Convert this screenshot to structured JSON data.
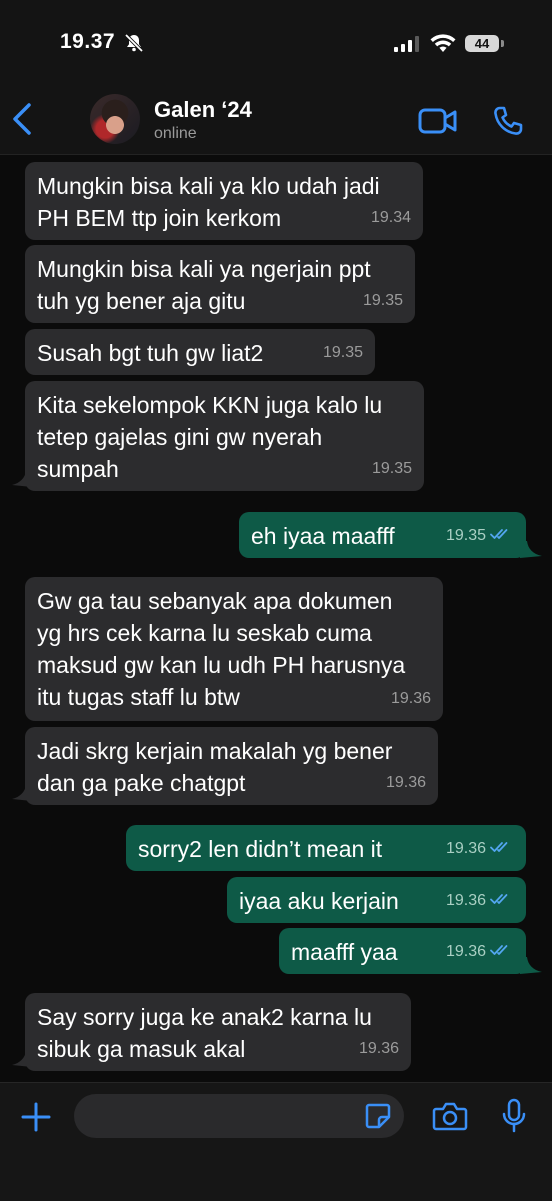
{
  "status_bar": {
    "time": "19.37",
    "battery": "44"
  },
  "header": {
    "contact_name": "Galen ‘24",
    "contact_status": "online"
  },
  "messages": [
    {
      "direction": "incoming",
      "text": "Mungkin bisa kali ya klo udah jadi\nPH BEM ttp join kerkom",
      "time": "19.34"
    },
    {
      "direction": "incoming",
      "text": "Mungkin bisa kali ya ngerjain ppt\ntuh yg bener aja gitu",
      "time": "19.35"
    },
    {
      "direction": "incoming",
      "text": "Susah bgt tuh gw liat2",
      "time": "19.35"
    },
    {
      "direction": "incoming",
      "text": "Kita sekelompok KKN juga kalo lu\ntetep gajelas gini gw nyerah\nsumpah",
      "time": "19.35"
    },
    {
      "direction": "outgoing",
      "text": "eh iyaa maafff",
      "time": "19.35",
      "status": "read"
    },
    {
      "direction": "incoming",
      "text": "Gw ga tau sebanyak apa dokumen\nyg hrs cek karna lu seskab cuma\nmaksud gw kan lu udh PH harusnya\nitu tugas staff lu btw",
      "time": "19.36"
    },
    {
      "direction": "incoming",
      "text": "Jadi skrg kerjain makalah yg bener\ndan ga pake chatgpt",
      "time": "19.36"
    },
    {
      "direction": "outgoing",
      "text": "sorry2 len didn’t mean it",
      "time": "19.36",
      "status": "read"
    },
    {
      "direction": "outgoing",
      "text": "iyaa aku kerjain",
      "time": "19.36",
      "status": "read"
    },
    {
      "direction": "outgoing",
      "text": "maafff yaa",
      "time": "19.36",
      "status": "read"
    },
    {
      "direction": "incoming",
      "text": "Say sorry juga ke anak2 karna lu\nsibuk ga masuk akal",
      "time": "19.36"
    }
  ],
  "input": {
    "placeholder": ""
  },
  "icons": {
    "back": "chevron-left-icon",
    "video_call": "video-camera-icon",
    "voice_call": "phone-icon",
    "mute": "bell-slash-icon",
    "attach": "plus-icon",
    "sticker": "sticker-icon",
    "camera": "camera-icon",
    "mic": "microphone-icon",
    "read_receipt": "double-check-icon"
  },
  "colors": {
    "accent": "#3a8ff7",
    "incoming_bubble": "#2c2c2e",
    "outgoing_bubble": "#0e5a47",
    "read_ticks": "#53a6f0",
    "background": "#0b0b0b"
  }
}
